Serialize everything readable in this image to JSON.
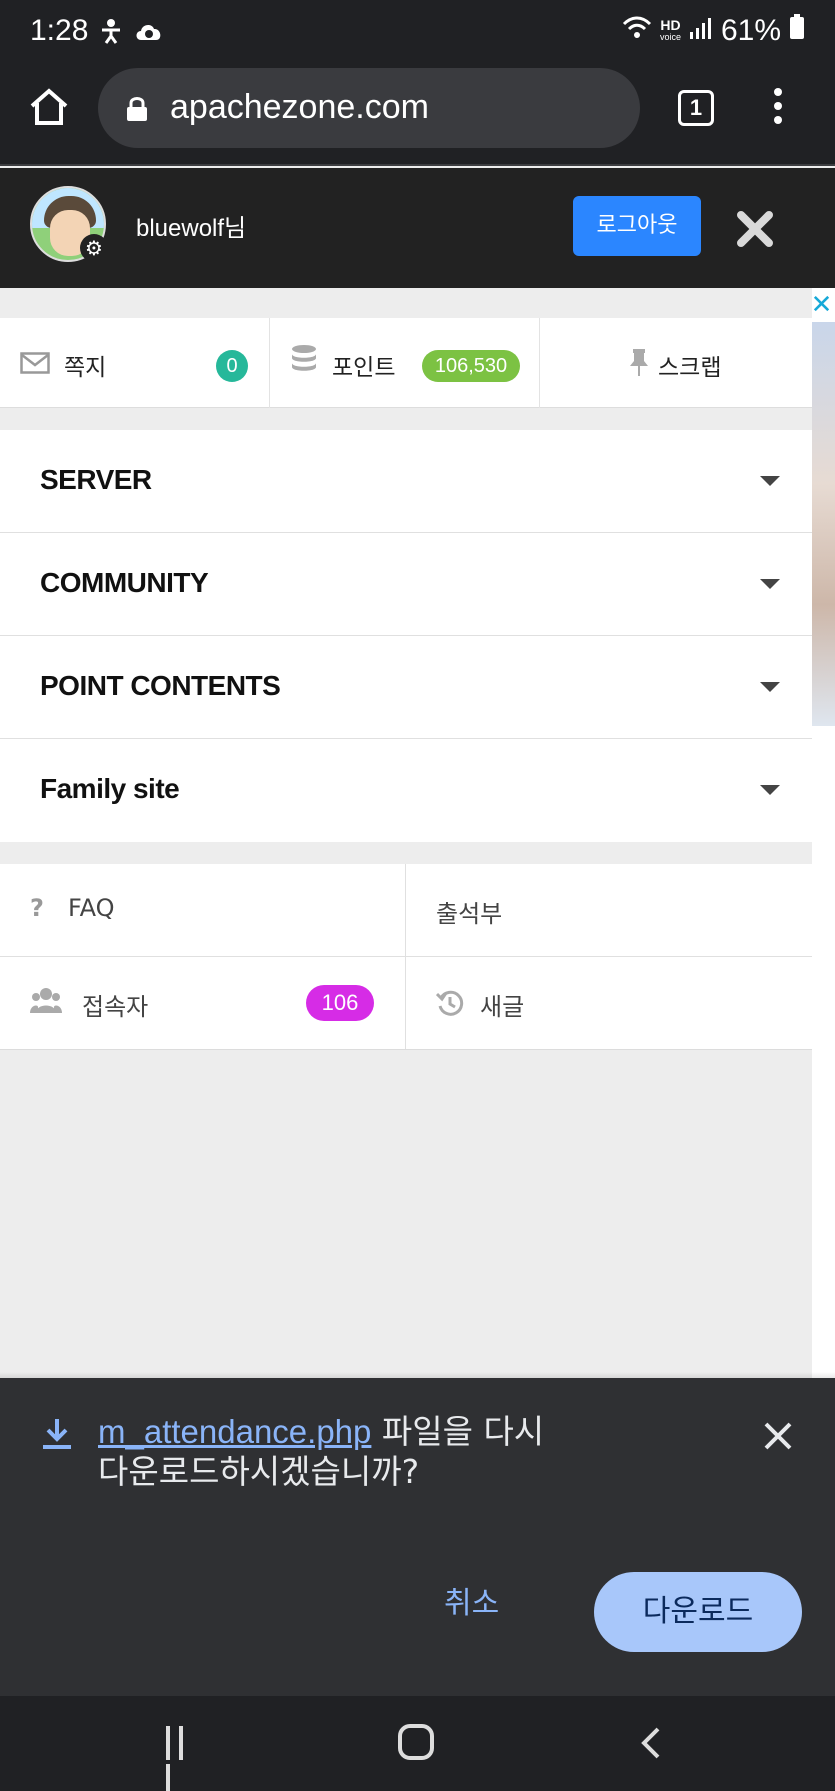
{
  "status_bar": {
    "time": "1:28",
    "battery": "61%",
    "network_hd": "HD",
    "network_voice": "voice"
  },
  "browser": {
    "url": "apachezone.com",
    "tab_count": "1"
  },
  "drawer": {
    "username": "bluewolf님",
    "logout_label": "로그아웃",
    "quick": {
      "messages_label": "쪽지",
      "messages_count": "0",
      "points_label": "포인트",
      "points_value": "106,530",
      "scrap_label": "스크랩"
    },
    "menu": [
      {
        "label": "SERVER"
      },
      {
        "label": "COMMUNITY"
      },
      {
        "label": "POINT CONTENTS"
      },
      {
        "label": "Family site"
      }
    ],
    "links": {
      "faq": "FAQ",
      "attendance": "출석부",
      "visitors": "접속자",
      "visitors_count": "106",
      "new_posts": "새글"
    }
  },
  "download_prompt": {
    "filename": "m_attendance.php",
    "message_part1": " 파일을 다시",
    "message_part2": "다운로드하시겠습니까?",
    "cancel_label": "취소",
    "download_label": "다운로드"
  },
  "colors": {
    "logout": "#2b86ff",
    "messages_badge": "#26b89a",
    "points_badge": "#7cc243",
    "visitors_badge": "#d62ce6",
    "link_blue": "#8ab4f8"
  }
}
